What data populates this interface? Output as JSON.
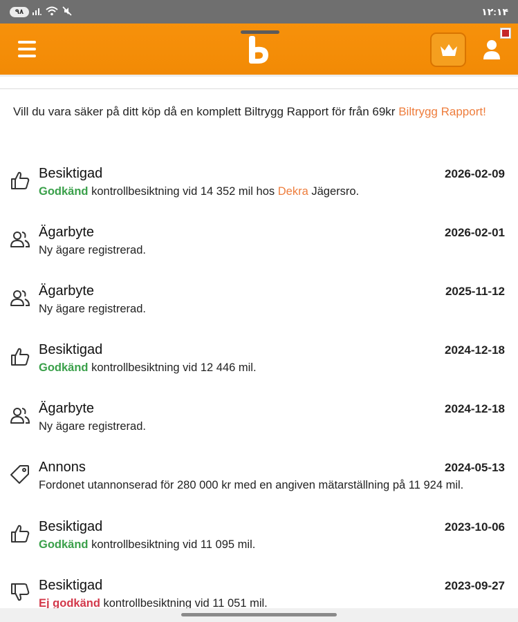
{
  "status_bar": {
    "battery": "۹۸",
    "time": "۱۲:۱۴"
  },
  "header": {
    "logo_alt": "b"
  },
  "promo": {
    "text": "Vill du vara säker på ditt köp då en komplett Biltrygg Rapport för från 69kr ",
    "link": "Biltrygg Rapport!"
  },
  "events": [
    {
      "icon": "thumbs-up-icon",
      "title": "Besiktigad",
      "date": "2026-02-09",
      "status": "Godkänd",
      "text": " kontrollbesiktning vid 14 352 mil hos ",
      "link": "Dekra",
      "suffix": " Jägersro."
    },
    {
      "icon": "people-icon",
      "title": "Ägarbyte",
      "date": "2026-02-01",
      "text": "Ny ägare registrerad."
    },
    {
      "icon": "people-icon",
      "title": "Ägarbyte",
      "date": "2025-11-12",
      "text": "Ny ägare registrerad."
    },
    {
      "icon": "thumbs-up-icon",
      "title": "Besiktigad",
      "date": "2024-12-18",
      "status": "Godkänd",
      "text": " kontrollbesiktning vid 12 446 mil."
    },
    {
      "icon": "people-icon",
      "title": "Ägarbyte",
      "date": "2024-12-18",
      "text": "Ny ägare registrerad."
    },
    {
      "icon": "tag-icon",
      "title": "Annons",
      "date": "2024-05-13",
      "text": "Fordonet utannonserad för 280 000 kr med en angiven mätarställning på 11 924 mil."
    },
    {
      "icon": "thumbs-up-icon",
      "title": "Besiktigad",
      "date": "2023-10-06",
      "status": "Godkänd",
      "text": " kontrollbesiktning vid 11 095 mil."
    },
    {
      "icon": "thumbs-down-icon",
      "title": "Besiktigad",
      "date": "2023-09-27",
      "status": "Ej godkänd",
      "text": " kontrollbesiktning vid 11 051 mil."
    }
  ]
}
